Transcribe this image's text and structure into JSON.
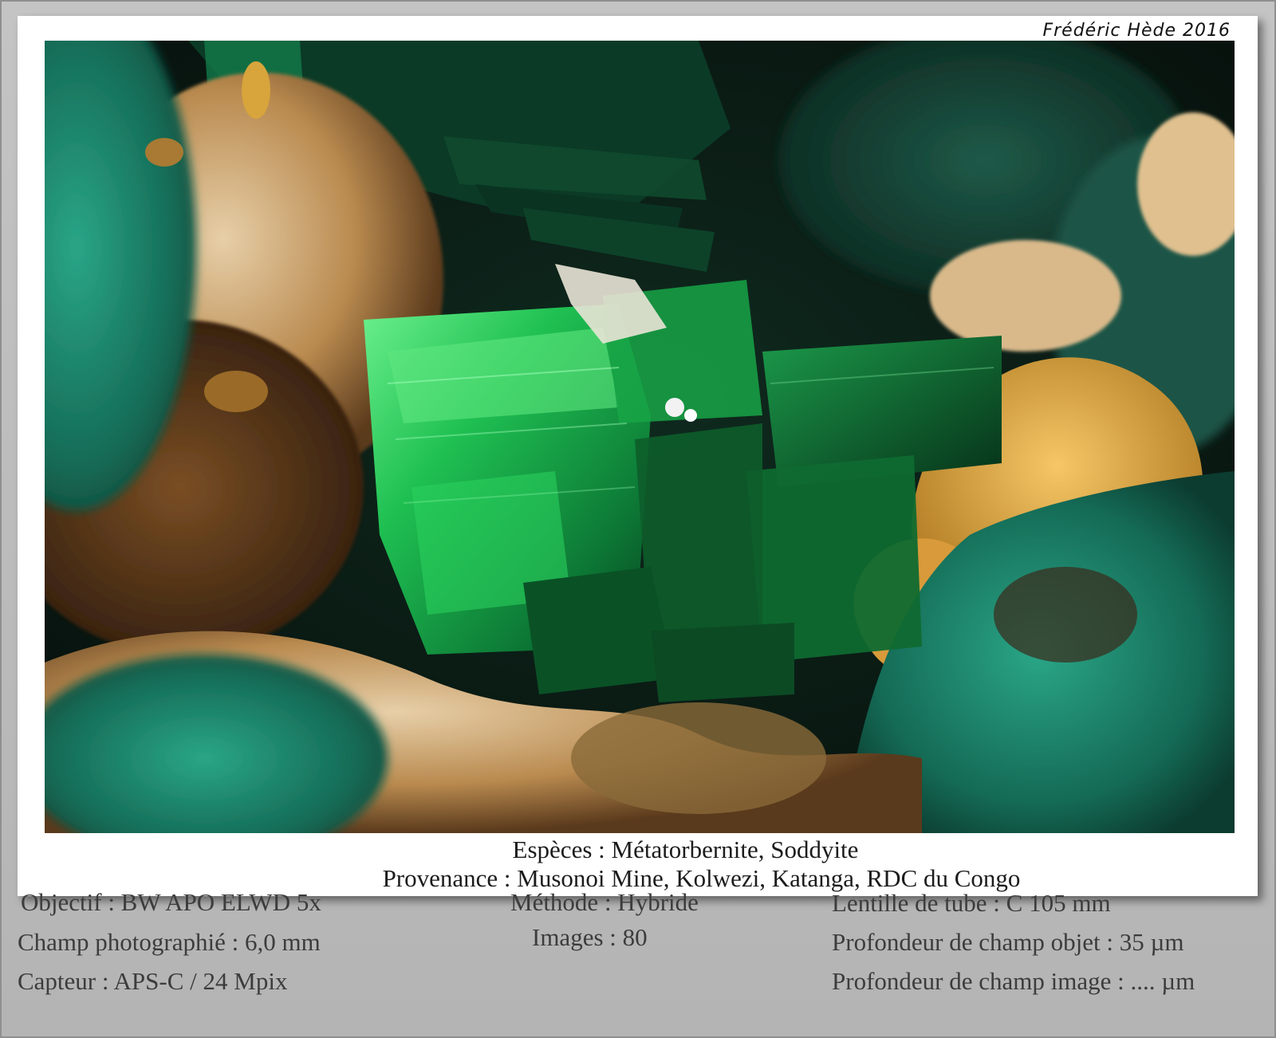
{
  "signature": "Frédéric Hède 2016",
  "caption": {
    "species": "Espèces : Métatorbernite, Soddyite",
    "provenance": "Provenance : Musonoi Mine, Kolwezi, Katanga, RDC du Congo"
  },
  "info_left": [
    "Objectif : BW APO ELWD 5x",
    "Champ photographié : 6,0 mm",
    "Capteur : APS-C / 24 Mpix"
  ],
  "info_center": [
    "Méthode : Hybride",
    "Images : 80"
  ],
  "info_right": [
    "Lentille de tube : C 105 mm",
    "Profondeur de champ objet : 35 µm",
    "Profondeur de champ image : .... µm"
  ],
  "colors": {
    "crystal_green": "#17b24a",
    "matrix_tan": "#c99a55",
    "soddyite_yellow": "#e3a93e",
    "malachite_teal": "#1f8a70",
    "background_gray": "#b9b9b9"
  }
}
